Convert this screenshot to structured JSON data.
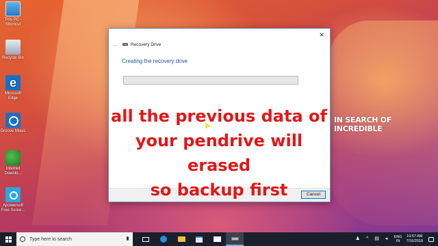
{
  "desktop": {
    "icons": [
      {
        "label": "This PC - Shortcut"
      },
      {
        "label": "Recycle Bin"
      },
      {
        "label": "Microsoft Edge"
      },
      {
        "label": "Groove Music"
      },
      {
        "label": "Internet Downlo..."
      },
      {
        "label": "Apowersoft Free Scree..."
      }
    ]
  },
  "dialog": {
    "title": "Recovery Drive",
    "heading": "Creating the recovery drive",
    "cancel_label": "Cancel",
    "close_glyph": "✕",
    "back_glyph": "←",
    "progress": 0
  },
  "overlay": {
    "line1": "all the previous data of",
    "line2": "your pendrive will erased",
    "line3": "so backup first",
    "color": "#e01818"
  },
  "tagline": "IN SEARCH OF INCREDIBLE",
  "taskbar": {
    "search_placeholder": "Type here to search",
    "language_top": "ENG",
    "language_bottom": "IN",
    "time": "10:57 AM",
    "date": "7/16/2018"
  }
}
